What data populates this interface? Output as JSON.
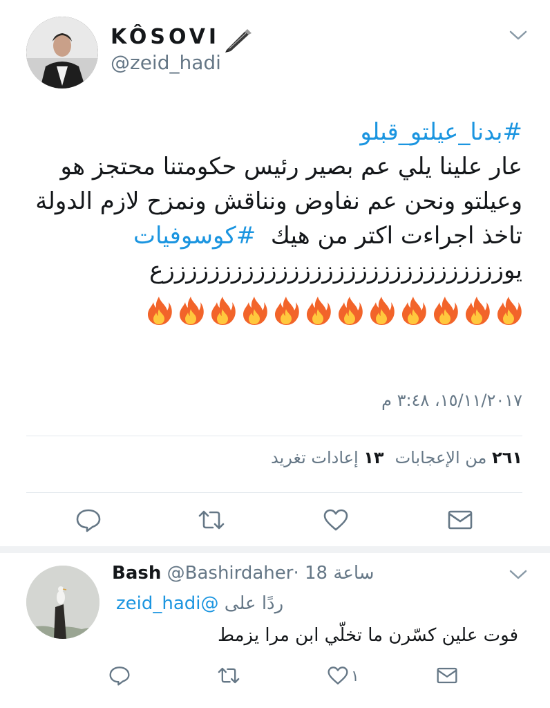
{
  "tweet": {
    "display_name": "KÔSOVI",
    "handle": "@zeid_hadi",
    "hashtag_top": "#بدنا_عيلتو_قبلو",
    "lines": [
      "عار علينا يلي عم بصير رئيس حكومتنا محتجز هو",
      "وعيلتو ونحن عم نفاوض ونناقش ونمزح لازم الدولة",
      "تاخذ اجراءت اكتر من هيك",
      "يوززززززززززززززززززززززززززززززع"
    ],
    "hashtag_inline": "#كوسوفيات",
    "fire_count": 12,
    "timestamp": "١٥/١١/٢٠١٧، ٣:٤٨ م",
    "stats": {
      "retweets_count": "١٣",
      "retweets_label": "إعادات تغريد",
      "likes_count": "٢٦١",
      "likes_label": "من الإعجابات"
    },
    "icons": [
      "pen-icon",
      "chevron-down-icon",
      "reply-icon",
      "retweet-icon",
      "like-icon",
      "message-icon",
      "fire-icon"
    ]
  },
  "reply": {
    "display_name": "Bash",
    "handle": "@Bashirdaher",
    "time": "· 18 ساعة",
    "reply_to_label": "ردًا على",
    "reply_to_mention": "@zeid_hadi",
    "text": "فوت علين كسّرن ما تخلّي ابن مرا يزمط",
    "like_count": "١"
  },
  "colors": {
    "link": "#1b95e0",
    "secondary_text": "#657786",
    "divider": "#e1e8ed",
    "fire_outer": "#f2642a",
    "fire_inner": "#ffc83d"
  }
}
